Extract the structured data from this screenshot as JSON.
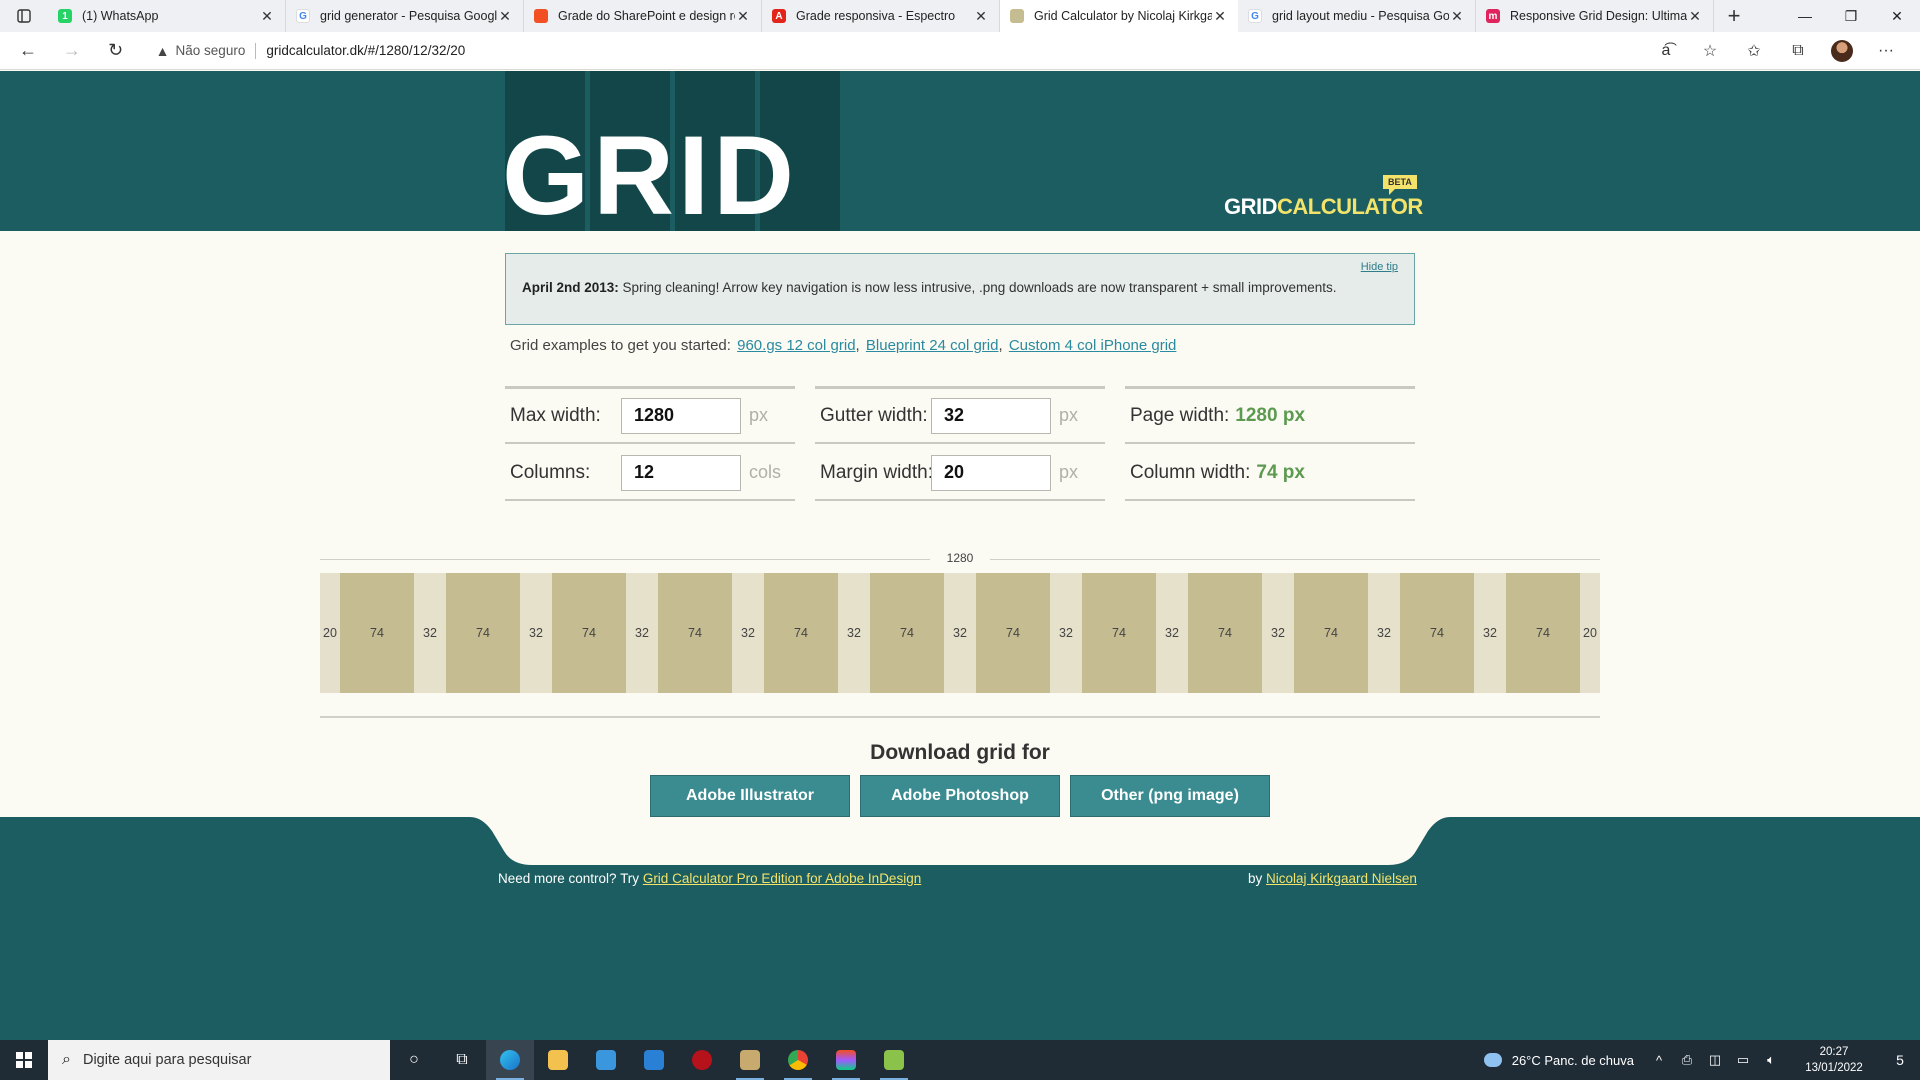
{
  "browser": {
    "tabs": [
      {
        "title": "(1) WhatsApp",
        "fav_color": "#25d366",
        "fav_glyph": "1",
        "active": false
      },
      {
        "title": "grid generator - Pesquisa Googl",
        "fav_color": "#ffffff",
        "fav_glyph": "G",
        "active": false
      },
      {
        "title": "Grade do SharePoint e design re",
        "fav_color": "#f25022",
        "fav_glyph": "",
        "active": false
      },
      {
        "title": "Grade responsiva - Espectro",
        "fav_color": "#e1251b",
        "fav_glyph": "A",
        "active": false
      },
      {
        "title": "Grid Calculator by Nicolaj Kirkga",
        "fav_color": "#c6bc92",
        "fav_glyph": "",
        "active": true
      },
      {
        "title": "grid layout mediu - Pesquisa Go",
        "fav_color": "#ffffff",
        "fav_glyph": "G",
        "active": false
      },
      {
        "title": "Responsive Grid Design: Ultimat",
        "fav_color": "#e0245e",
        "fav_glyph": "m",
        "active": false
      }
    ],
    "insecure_label": "Não seguro",
    "url": "gridcalculator.dk/#/1280/12/32/20"
  },
  "header": {
    "logo": "GRID",
    "brand_white": "GRID",
    "brand_yellow": "CALCULATOR",
    "beta": "BETA"
  },
  "tip": {
    "hide": "Hide tip",
    "date": "April 2nd 2013:",
    "text": " Spring cleaning! Arrow key navigation is now less intrusive, .png downloads are now transparent + small improvements."
  },
  "examples": {
    "lead": "Grid examples to get you started:",
    "links": [
      "960.gs 12 col grid",
      "Blueprint 24 col grid",
      "Custom 4 col iPhone grid"
    ]
  },
  "calculator": {
    "max_width": {
      "label": "Max width:",
      "value": "1280",
      "unit": "px"
    },
    "columns": {
      "label": "Columns:",
      "value": "12",
      "unit": "cols"
    },
    "gutter_width": {
      "label": "Gutter width:",
      "value": "32",
      "unit": "px"
    },
    "margin_width": {
      "label": "Margin width:",
      "value": "20",
      "unit": "px"
    },
    "page_width": {
      "label": "Page width:",
      "value": "1280 px"
    },
    "column_width": {
      "label": "Column width:",
      "value": "74 px"
    }
  },
  "grid_preview": {
    "total_label": "1280",
    "margin": 20,
    "column": 74,
    "gutter": 32,
    "columns": 12
  },
  "download": {
    "title": "Download grid for",
    "buttons": [
      "Adobe Illustrator",
      "Adobe Photoshop",
      "Other (png image)"
    ]
  },
  "footer": {
    "left_text": "Need more control? Try ",
    "left_link": "Grid Calculator Pro Edition for Adobe InDesign",
    "right_text": "by ",
    "right_link": "Nicolaj Kirkgaard Nielsen"
  },
  "taskbar": {
    "search_placeholder": "Digite aqui para pesquisar",
    "weather": "26°C  Panc. de chuva",
    "time": "20:27",
    "date": "13/01/2022",
    "notifications": "5"
  }
}
